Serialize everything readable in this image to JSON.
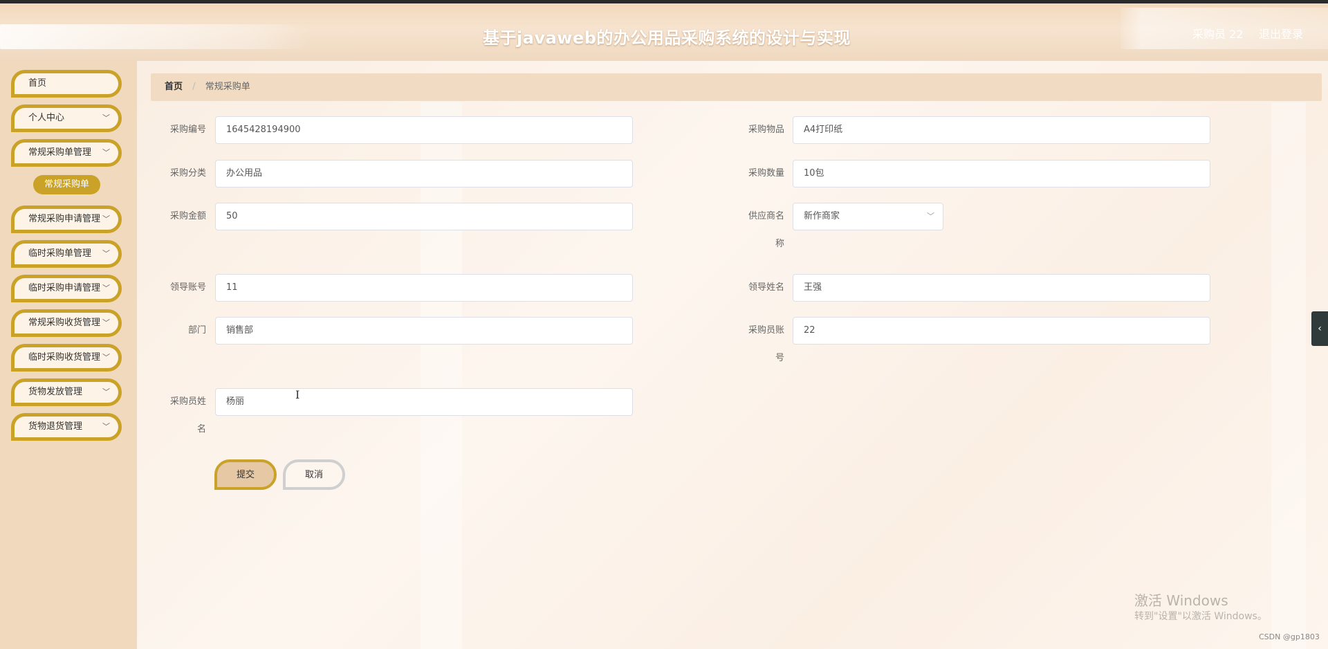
{
  "header": {
    "title": "基于javaweb的办公用品采购系统的设计与实现",
    "user": "采购员 22",
    "logout": "退出登录"
  },
  "sidebar": {
    "items": [
      {
        "label": "首页"
      },
      {
        "label": "个人中心"
      },
      {
        "label": "常规采购单管理"
      },
      {
        "label": "常规采购申请管理"
      },
      {
        "label": "临时采购单管理"
      },
      {
        "label": "临时采购申请管理"
      },
      {
        "label": "常规采购收货管理"
      },
      {
        "label": "临时采购收货管理"
      },
      {
        "label": "货物发放管理"
      },
      {
        "label": "货物退货管理"
      }
    ],
    "active_sub": "常规采购单"
  },
  "breadcrumb": {
    "home": "首页",
    "separator": "/",
    "current": "常规采购单"
  },
  "form": {
    "purchase_no": {
      "label": "采购编号",
      "value": "1645428194900"
    },
    "purchase_item": {
      "label": "采购物品",
      "value": "A4打印纸"
    },
    "category": {
      "label": "采购分类",
      "value": "办公用品"
    },
    "quantity": {
      "label": "采购数量",
      "value": "10包"
    },
    "amount": {
      "label": "采购金额",
      "value": "50"
    },
    "supplier": {
      "label_line1": "供应商名",
      "label_line2": "称",
      "value": "新作商家"
    },
    "leader_account": {
      "label": "领导账号",
      "value": "11"
    },
    "leader_name": {
      "label": "领导姓名",
      "value": "王强"
    },
    "department": {
      "label": "部门",
      "value": "销售部"
    },
    "buyer_account": {
      "label_line1": "采购员账",
      "label_line2": "号",
      "value": "22"
    },
    "buyer_name": {
      "label_line1": "采购员姓",
      "label_line2": "名",
      "value": "杨丽"
    },
    "submit": "提交",
    "cancel": "取消"
  },
  "watermark": {
    "line1": "激活 Windows",
    "line2": "转到\"设置\"以激活 Windows。",
    "csdn": "CSDN @gp1803"
  },
  "right_tab_icon": "chevron-left-icon"
}
